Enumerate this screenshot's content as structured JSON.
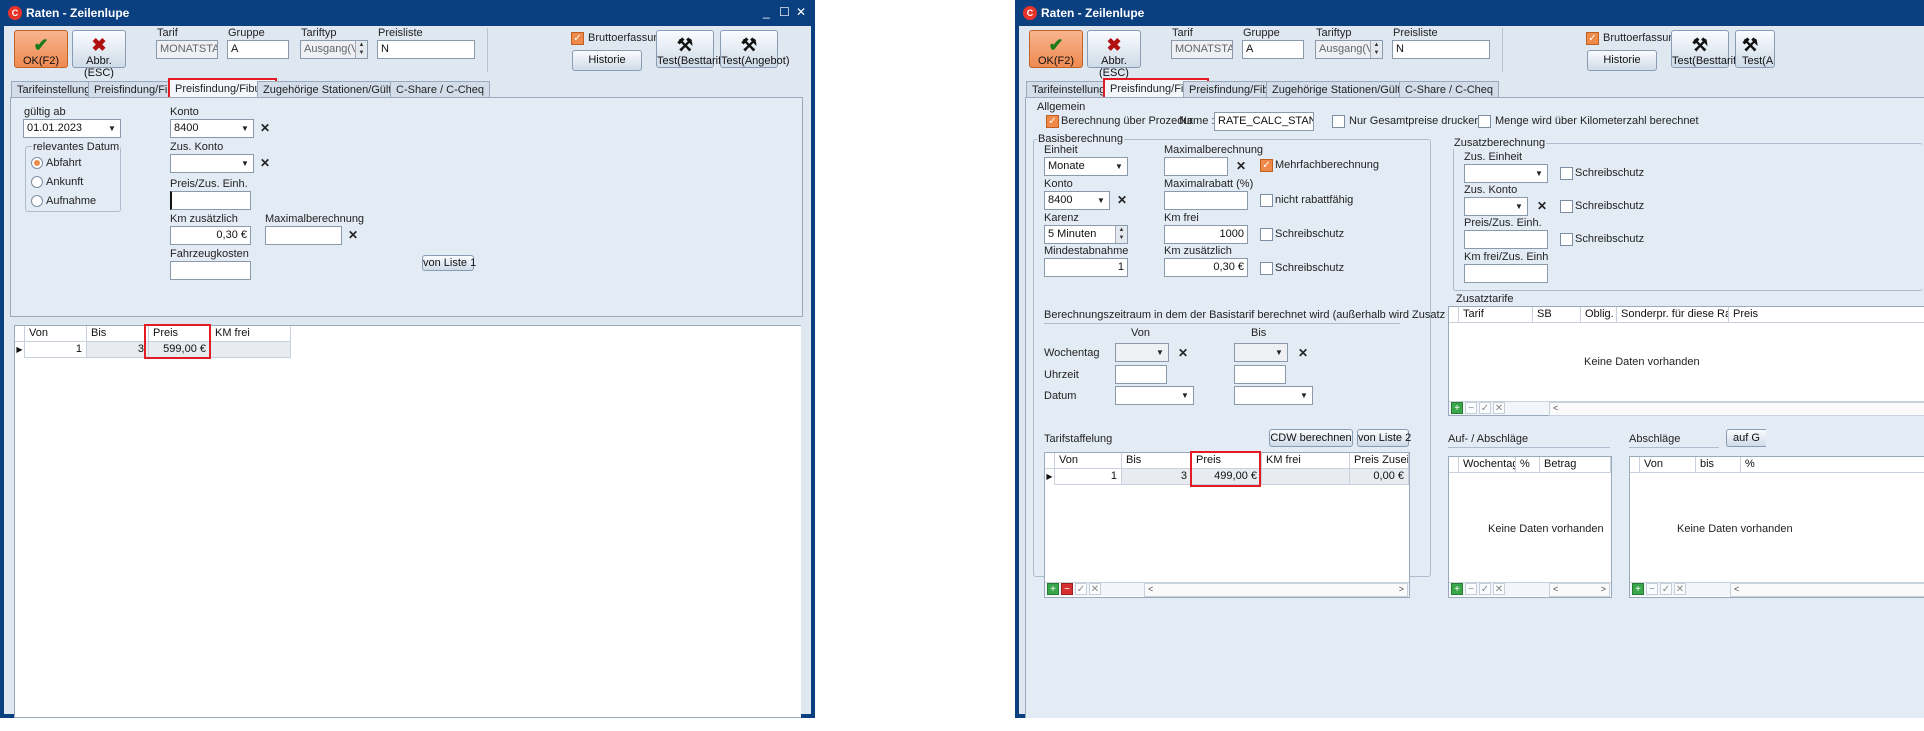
{
  "app_icon": "C",
  "left_window": {
    "title": "Raten - Zeilenlupe",
    "ok_label": "OK(F2)",
    "abbr_label": "Abbr.(ESC)",
    "tarif_label": "Tarif",
    "tarif_value": "MONATSTAR",
    "gruppe_label": "Gruppe",
    "gruppe_value": "A",
    "tariftyp_label": "Tariftyp",
    "tariftyp_value": "Ausgang(Ver",
    "preisliste_label": "Preisliste",
    "preisliste_value": "N",
    "brutto_label": "Bruttoerfassung",
    "brutto_checked": true,
    "historie_label": "Historie",
    "test_besttarif": "Test(Besttarif)",
    "test_angebot": "Test(Angebot)",
    "tabs": [
      "Tarifeinstellungen",
      "Preisfindung/Fibu I",
      "Preisfindung/Fibu II",
      "Zugehörige Stationen/Gültigkeit",
      "C-Share / C-Cheq"
    ],
    "active_tab": 2,
    "gueltig_label": "gültig ab",
    "gueltig_value": "01.01.2023",
    "relevant_label": "relevantes Datum",
    "radio_options": [
      "Abfahrt",
      "Ankunft",
      "Aufnahme"
    ],
    "radio_selected": 0,
    "konto_label": "Konto",
    "konto_value": "8400",
    "zus_konto_label": "Zus. Konto",
    "zus_konto_value": "",
    "preis_zus_label": "Preis/Zus. Einh.",
    "preis_zus_value": "",
    "km_zus_label": "Km zusätzlich",
    "km_zus_value": "0,30 €",
    "maxber_label": "Maximalberechnung",
    "maxber_value": "",
    "fahrzeug_label": "Fahrzeugkosten",
    "fahrzeug_value": "",
    "von_liste_label": "von Liste 1",
    "grid_headers": [
      "Von",
      "Bis",
      "Preis",
      "KM frei"
    ],
    "grid_row": {
      "von": "1",
      "bis": "3",
      "preis": "599,00 €",
      "km": ""
    }
  },
  "right_window": {
    "title": "Raten - Zeilenlupe",
    "ok_label": "OK(F2)",
    "abbr_label": "Abbr.(ESC)",
    "tarif_label": "Tarif",
    "tarif_value": "MONATSTAR",
    "gruppe_label": "Gruppe",
    "gruppe_value": "A",
    "tariftyp_label": "Tariftyp",
    "tariftyp_value": "Ausgang(Ver",
    "preisliste_label": "Preisliste",
    "preisliste_value": "N",
    "brutto_label": "Bruttoerfassung",
    "brutto_checked": true,
    "historie_label": "Historie",
    "test_besttarif": "Test(Besttarif)",
    "test_angebot": "Test(A",
    "tabs": [
      "Tarifeinstellungen",
      "Preisfindung/Fibu I",
      "Preisfindung/Fibu II",
      "Zugehörige Stationen/Gültigkeit",
      "C-Share / C-Cheq"
    ],
    "active_tab": 1,
    "allgemein_label": "Allgemein",
    "ber_prozedur_label": "Berechnung über Prozedur",
    "ber_prozedur_checked": true,
    "name_label": "Name :",
    "name_value": "RATE_CALC_STANDAR",
    "nur_gesamt_label": "Nur Gesamtpreise drucken",
    "menge_km_label": "Menge wird über Kilometerzahl berechnet",
    "basis_label": "Basisberechnung",
    "einheit_label": "Einheit",
    "einheit_value": "Monate",
    "maxber_label": "Maximalberechnung",
    "maxber_value": "",
    "mehrfach_label": "Mehrfachberechnung",
    "mehrfach_checked": true,
    "konto_label": "Konto",
    "konto_value": "8400",
    "maxrabatt_label": "Maximalrabatt (%)",
    "maxrabatt_value": "",
    "nicht_rabatt_label": "nicht rabattfähig",
    "karenz_label": "Karenz",
    "karenz_value": "5 Minuten",
    "kmfrei_label": "Km frei",
    "kmfrei_value": "1000",
    "schreibschutz_label": "Schreibschutz",
    "mindest_label": "Mindestabnahme",
    "mindest_value": "1",
    "kmzus_label": "Km zusätzlich",
    "kmzus_value": "0,30 €",
    "zusatz_label": "Zusatzberechnung",
    "zus_einheit_label": "Zus. Einheit",
    "zus_konto_label": "Zus. Konto",
    "preis_zus_label": "Preis/Zus. Einh.",
    "kmfrei_zus_label": "Km frei/Zus. Einh",
    "zeitraum_label": "Berechnungszeitraum in dem der Basistarif berechnet wird (außerhalb wird Zusatz berechnet)",
    "von_label": "Von",
    "bis_label": "Bis",
    "wochentag_label": "Wochentag",
    "uhrzeit_label": "Uhrzeit",
    "datum_label": "Datum",
    "zusatztarife_label": "Zusatztarife",
    "zusatz_headers": [
      "Tarif",
      "SB",
      "Oblig.",
      "Sonderpr. für diese Rate",
      "Preis"
    ],
    "keine_daten": "Keine Daten vorhanden",
    "staffelung_label": "Tarifstaffelung",
    "cdw_label": "CDW berechnen",
    "von_liste2_label": "von Liste 2",
    "staffel_headers": [
      "Von",
      "Bis",
      "Preis",
      "KM frei",
      "Preis Zuseinh"
    ],
    "staffel_row": {
      "von": "1",
      "bis": "3",
      "preis": "499,00 €",
      "km": "",
      "zus": "0,00 €"
    },
    "aufab_label": "Auf- / Abschläge",
    "aufab_headers": [
      "Wochentag",
      "%",
      "Betrag"
    ],
    "abschlaege_label": "Abschläge",
    "auf_btn_label": "auf G",
    "ab_headers": [
      "Von",
      "bis",
      "%"
    ]
  }
}
